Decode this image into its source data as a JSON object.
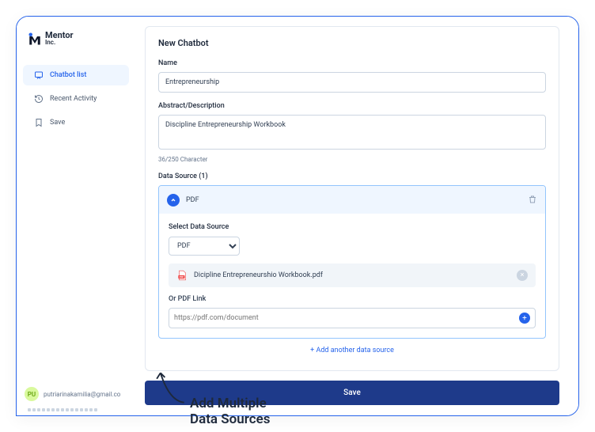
{
  "brand": {
    "name": "Mentor",
    "sub": "Inc."
  },
  "sidebar": {
    "items": [
      {
        "label": "Chatbot list"
      },
      {
        "label": "Recent Activity"
      },
      {
        "label": "Save"
      }
    ],
    "user": {
      "initials": "PU",
      "email": "putriarinakamilia@gmail.co"
    }
  },
  "page": {
    "title": "New Chatbot",
    "name_label": "Name",
    "name_value": "Entrepreneurship",
    "abstract_label": "Abstract/Description",
    "abstract_value": "Discipline Entrepreneurship Workbook",
    "char_count": "36/250 Character",
    "ds_label": "Data Source (1)",
    "ds": {
      "type": "PDF",
      "select_label": "Select Data Source",
      "select_value": "PDF",
      "file_name": "Dicipline Entrepreneurshio Workbook.pdf",
      "or_label": "Or PDF Link",
      "link_placeholder": "https://pdf.com/document"
    },
    "add_another": "+ Add another data source",
    "save": "Save"
  },
  "annotation": {
    "line1": "Add Multiple",
    "line2": "Data Sources"
  }
}
